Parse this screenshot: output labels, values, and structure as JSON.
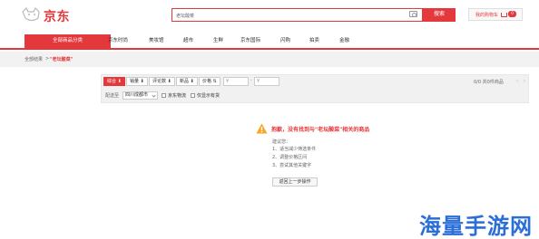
{
  "colors": {
    "brand": "#e4393c",
    "watermark": "#2a6ed8"
  },
  "header": {
    "logo_text": "京东",
    "search_value": "老坛酸菜",
    "search_button": "搜索",
    "cart_label": "我的购物车",
    "cart_count": "0"
  },
  "nav": {
    "category": "全部商品分类",
    "items": [
      "京东时尚",
      "美妆馆",
      "超市",
      "生鲜",
      "京东国际",
      "闪购",
      "拍卖",
      "金融"
    ]
  },
  "breadcrumb": {
    "all": "全部结果",
    "sep": ">",
    "keyword": "\"老坛酸菜\""
  },
  "filter": {
    "sorts": [
      "综合",
      "销量",
      "评论数",
      "新品",
      "价格"
    ],
    "price_from": "¥",
    "price_to": "¥",
    "price_dash": "-",
    "pager_count": "0/0 共0件商品",
    "pager_prev": "<",
    "pager_next": ">",
    "ship_label": "配送至",
    "region": "四川成都市",
    "checkbox1": "京东物流",
    "checkbox2": "仅显示有货"
  },
  "empty": {
    "title": "抱歉，没有找到与\"老坛酸菜\"相关的商品",
    "suggest_head": "建议您：",
    "suggestions": [
      "1、适当减少筛选条件",
      "2、调整价格区间",
      "3、尝试其他关键字"
    ],
    "back_button": "返回上一步操作"
  },
  "watermark": {
    "text": "海量手游网"
  }
}
